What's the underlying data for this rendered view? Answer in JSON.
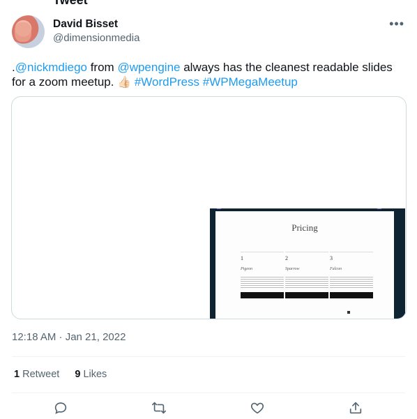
{
  "header": {
    "title_partial": "Tweet"
  },
  "author": {
    "name": "David Bisset",
    "handle": "@dimensionmedia"
  },
  "tweet": {
    "prefix": ".",
    "mention1": "@nickmdiego",
    "text1": " from ",
    "mention2": "@wpengine",
    "text2": " always has the cleanest readable slides for a zoom meetup. ",
    "emoji": "👍🏻",
    "hashtag1": "#WordPress",
    "hashtag2": "#WPMegaMeetup"
  },
  "slide": {
    "title": "Pricing",
    "columns": [
      {
        "num": "1",
        "tier": "Pigeon"
      },
      {
        "num": "2",
        "tier": "Sparrow"
      },
      {
        "num": "3",
        "tier": "Falcon"
      }
    ]
  },
  "timestamp": "12:18 AM · Jan 21, 2022",
  "stats": {
    "retweets": "1",
    "retweets_label": "Retweet",
    "likes": "9",
    "likes_label": "Likes"
  },
  "icons": {
    "more": "more-icon",
    "reply": "reply-icon",
    "retweet": "retweet-icon",
    "like": "like-icon",
    "share": "share-icon"
  },
  "colors": {
    "link": "#1d9bf0",
    "secondary": "#536471",
    "text": "#0f1419"
  }
}
